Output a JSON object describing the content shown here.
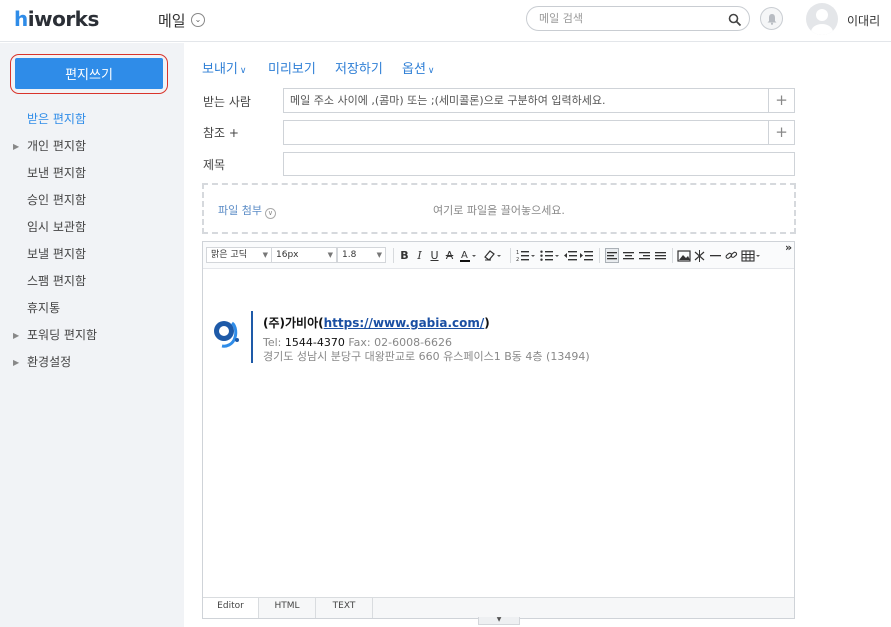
{
  "header": {
    "logo_h": "h",
    "logo_rest": "iworks",
    "app_title": "메일",
    "search_placeholder": "메일 검색",
    "username": "이대리"
  },
  "sidebar": {
    "compose_label": "편지쓰기",
    "items": [
      {
        "label": "받은 편지함",
        "active": true,
        "expandable": false
      },
      {
        "label": "개인 편지함",
        "active": false,
        "expandable": true
      },
      {
        "label": "보낸 편지함",
        "active": false,
        "expandable": false
      },
      {
        "label": "승인 편지함",
        "active": false,
        "expandable": false
      },
      {
        "label": "임시 보관함",
        "active": false,
        "expandable": false
      },
      {
        "label": "보낼 편지함",
        "active": false,
        "expandable": false
      },
      {
        "label": "스팸 편지함",
        "active": false,
        "expandable": false
      },
      {
        "label": "휴지통",
        "active": false,
        "expandable": false
      },
      {
        "label": "포워딩 편지함",
        "active": false,
        "expandable": true
      },
      {
        "label": "환경설정",
        "active": false,
        "expandable": true
      }
    ]
  },
  "compose": {
    "actions": {
      "send": "보내기",
      "preview": "미리보기",
      "save": "저장하기",
      "options": "옵션"
    },
    "to_label": "받는 사람",
    "to_placeholder": "메일 주소 사이에 ,(콤마) 또는 ;(세미콜론)으로 구분하여 입력하세요.",
    "cc_label": "참조 +",
    "subject_label": "제목",
    "attach_label": "파일 첨부",
    "attach_hint": "여기로 파일을 끌어놓으세요."
  },
  "editor": {
    "font_family": "맑은 고딕",
    "font_size": "16px",
    "line_height": "1.8",
    "tabs": [
      "Editor",
      "HTML",
      "TEXT"
    ],
    "active_tab": "Editor"
  },
  "signature": {
    "company_prefix": "(주)가비아(",
    "company_link": "https://www.gabia.com/",
    "company_suffix": ")",
    "tel_label": "Tel:",
    "tel_value": "1544-4370",
    "fax": "Fax: 02-6008-6626",
    "address": "경기도 성남시 분당구 대왕판교로 660 유스페이스1 B동 4층 (13494)"
  },
  "colors": {
    "accent": "#2f8ce8",
    "highlight_ring": "#d9342b",
    "sidebar_bg": "#f1f3f6",
    "link": "#2f7fd6"
  }
}
